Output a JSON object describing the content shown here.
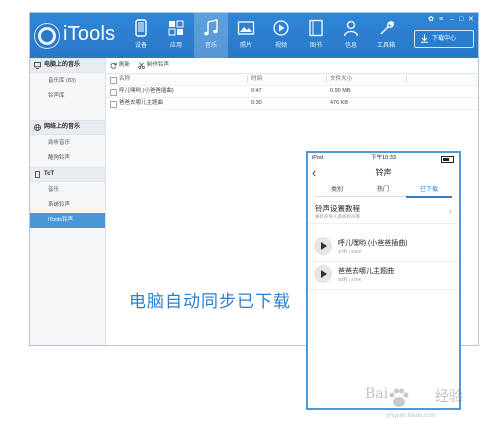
{
  "app": {
    "logo_text": "iTools",
    "nav": [
      {
        "label": "设备",
        "icon": "device-icon"
      },
      {
        "label": "应用",
        "icon": "apps-icon"
      },
      {
        "label": "音乐",
        "icon": "music-icon",
        "active": true
      },
      {
        "label": "照片",
        "icon": "photo-icon"
      },
      {
        "label": "视频",
        "icon": "video-icon"
      },
      {
        "label": "图书",
        "icon": "book-icon"
      },
      {
        "label": "信息",
        "icon": "user-icon"
      },
      {
        "label": "工具箱",
        "icon": "toolbox-icon"
      }
    ],
    "download_center": "下载中心",
    "accent": "#2a78c8"
  },
  "sidebar": {
    "sections": [
      {
        "title": "电脑上的音乐",
        "icon": "computer-icon",
        "items": [
          "音乐库 (83)",
          "铃声库"
        ]
      },
      {
        "title": "网络上的音乐",
        "icon": "globe-icon",
        "items": [
          "劲听音乐",
          "酷狗铃声"
        ]
      },
      {
        "title": "TcT",
        "icon": "phone-icon",
        "items": [
          "音乐",
          "系统铃声",
          "iTools铃声"
        ]
      }
    ],
    "active_item": "iTools铃声"
  },
  "toolbar": {
    "refresh": "刷新",
    "make_ringtone": "制作铃声"
  },
  "table": {
    "headers": {
      "name": "名称",
      "time": "时间",
      "size": "文件大小"
    },
    "rows": [
      {
        "name": "呼儿嘿哟 (小爸爸插曲)",
        "time": "0:47",
        "size": "0.90 MB"
      },
      {
        "name": "爸爸去哪儿主题曲",
        "time": "0:30",
        "size": "476 KB"
      }
    ]
  },
  "caption": "电脑自动同步已下载",
  "phone": {
    "status_left": "iPod",
    "status_time": "下午10:33",
    "title": "铃声",
    "tabs": [
      "类别",
      "热门",
      "已下载"
    ],
    "active_tab": "已下载",
    "tutorial_title": "铃声设置教程",
    "tutorial_sub": "将铃声导入系统铃声库",
    "songs": [
      {
        "name": "呼儿嘿哟 (小爸爸插曲)",
        "meta": "47秒 | 925K"
      },
      {
        "name": "爸爸去哪儿主题曲",
        "meta": "30秒 | 476K"
      }
    ]
  },
  "watermark": {
    "left": "Bai",
    "right": "经验",
    "url": "jingyan.baidu.com"
  }
}
